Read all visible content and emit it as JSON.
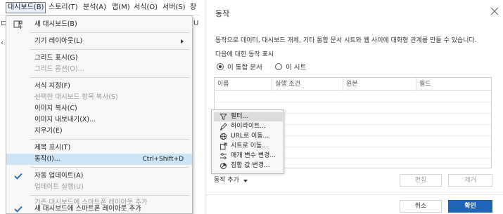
{
  "menubar": {
    "items": [
      {
        "label": "대시보드(B)"
      },
      {
        "label": "스토리(T)"
      },
      {
        "label": "분석(A)"
      },
      {
        "label": "맵(M)"
      },
      {
        "label": "서식(O)"
      },
      {
        "label": "서버(S)"
      },
      {
        "label": "창"
      }
    ]
  },
  "dashboard_menu": {
    "items": [
      {
        "label": "새 대시보드(B)",
        "icon": "new-dashboard-icon"
      },
      {
        "label": "기기 레이아웃(L)",
        "submenu": true
      },
      {
        "label": "그리드 표시(G)"
      },
      {
        "label": "그리드 옵션(O)...",
        "disabled": true
      },
      {
        "label": "서식 지정(F)"
      },
      {
        "label": "선택한 대시보드 항목 복사(S)",
        "disabled": true
      },
      {
        "label": "이미지 복사(C)"
      },
      {
        "label": "이미지 내보내기(X)..."
      },
      {
        "label": "지우기(E)"
      },
      {
        "label": "제목 표시(T)"
      },
      {
        "label": "동작(I)...",
        "shortcut": "Ctrl+Shift+D",
        "highlight": true
      },
      {
        "label": "자동 업데이트(A)",
        "checked": true
      },
      {
        "label": "업데이트 실행(U)",
        "disabled": true
      },
      {
        "label": "기존 대시보드에 스마트폰 레이아웃 추가",
        "disabled": true
      },
      {
        "label": "새 대시보드에 스마트폰 레이아웃 추가",
        "checked": true
      }
    ]
  },
  "dialog": {
    "title": "동작",
    "description": "동작으로 데이터, 대시보드 개체, 기타 통합 문서 시트와 웹 사이에 대화형 관계를 만들 수 있습니다.",
    "show_label": "다음에 대한 동작 표시",
    "radio_workbook": "이 통합 문서",
    "radio_sheet": "이 시트",
    "columns": [
      "이름",
      "실행 조건",
      "원본",
      "필드"
    ],
    "add_action_label": "동작 추가",
    "edit_label": "편집",
    "remove_label": "제거",
    "cancel_label": "취소",
    "ok_label": "확인"
  },
  "add_action_menu": {
    "items": [
      {
        "label": "필터...",
        "icon": "filter-icon",
        "highlight": true
      },
      {
        "label": "하이라이트...",
        "icon": "highlighter-icon"
      },
      {
        "label": "URL로 이동...",
        "icon": "globe-icon"
      },
      {
        "label": "시트로 이동...",
        "icon": "sheet-icon"
      },
      {
        "label": "매개 변수 변경...",
        "icon": "parameter-icon"
      },
      {
        "label": "집합 값 변경...",
        "icon": "set-icon"
      }
    ]
  }
}
